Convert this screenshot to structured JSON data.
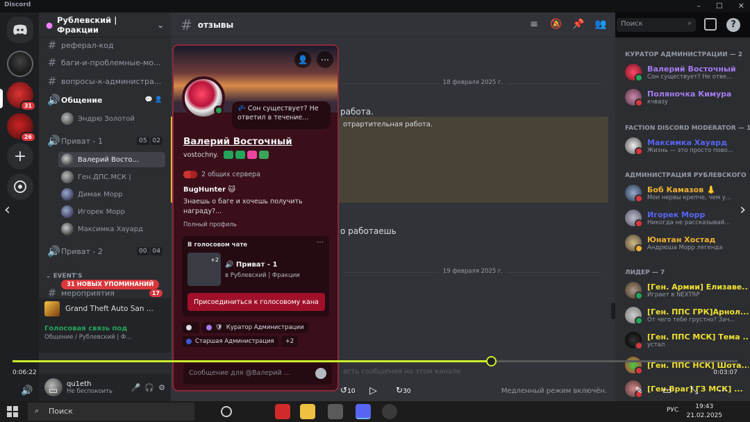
{
  "window": {
    "app": "Discord"
  },
  "rail": {
    "badges": [
      "31",
      "26"
    ]
  },
  "guild": {
    "name": "Рублевский | Фракции"
  },
  "channels": {
    "c1": "реферал-код",
    "c2": "баги-и-проблемные-мо...",
    "c3": "вопросы-к-администра...",
    "voice_general": "Общение",
    "voice_general_user": "Эндрю Золотой",
    "private1": "Приват - 1",
    "private1_counts": [
      "05",
      "02"
    ],
    "private1_users": [
      "Валерий Восто...",
      "Ген.ДПС.МСК |",
      "Димак Морр",
      "Игорек Морр",
      "Максимка Хауард"
    ],
    "private2": "Приват - 2",
    "private2_counts": [
      "00",
      "04"
    ],
    "events_category": "EVENT'S",
    "events_channel": "мероприятия",
    "events_badge": "17",
    "mentions_pill": "31 НОВЫХ УПОМИНАНИЙ"
  },
  "activity": {
    "game": "Grand Theft Auto San ..."
  },
  "voice_status": {
    "title": "Голосовая связь под",
    "sub": "Общение / Рублевский | Ф..."
  },
  "user_panel": {
    "name": "qu1eth",
    "status": "Не беспокоить"
  },
  "chat": {
    "channel": "отзывы",
    "date1": "18 февраля 2025 г.",
    "date2": "19 февраля 2025 г.",
    "line1": "работа.",
    "line2": "отрартительная работа.",
    "line3": "о работаешь",
    "slow_mode": "Медленный режим включён.",
    "footer_hint": "асть сообщения на этом канале"
  },
  "search": {
    "placeholder": "Поиск"
  },
  "members": {
    "categories": [
      "КУРАТОР АДМИНИСТРАЦИИ — 2",
      "FACTION DISCORD MODERATOR — 1",
      "АДМИНИСТРАЦИЯ РУБЛЕВСКОГО",
      "ЛИДЕР — 7"
    ],
    "list": [
      {
        "name": "Валерий Восточный",
        "status": "Сон существует? Не отве...",
        "color": "#a57cf0"
      },
      {
        "name": "Поляночка Кимура",
        "status": "кчвазу",
        "color": "#a57cf0"
      },
      {
        "name": "Максимка Хауард",
        "status": "Жизнь — это просто пово...",
        "color": "#5865f2"
      },
      {
        "name": "Боб Камазов 👃",
        "status": "Мои нервы крепче, чем у...",
        "color": "#f0b232"
      },
      {
        "name": "Игорек Морр",
        "status": "Никогда не рассказывай...",
        "color": "#5865f2"
      },
      {
        "name": "Юнатан Хостад",
        "status": "Андрюша Морр легенда",
        "color": "#f0b232"
      },
      {
        "name": "[Ген. Армии] Елизаве...",
        "status": "Играет в NEXTRP",
        "color": "#f0e032"
      },
      {
        "name": "[Ген. ППС ГРК]Арнол...",
        "status": "От чего тебе грустно? Зач...",
        "color": "#f0e032"
      },
      {
        "name": "[Ген. ППС МСК] Тема ...",
        "status": "устал",
        "color": "#f0e032"
      },
      {
        "name": "[Ген. ППС НСК] Шота...",
        "status": "",
        "color": "#f0e032"
      },
      {
        "name": "[Ген.Враг] ГЗ МСК] ...",
        "status": "",
        "color": "#f0e032"
      }
    ]
  },
  "profile": {
    "display_name": "Валерий Восточный",
    "username": "vostochny.",
    "custom_status": "Сон существует? Не ответил в течение...",
    "mutual_servers": "2 общих сервера",
    "bio_title": "BugHunter 🐱",
    "bio_text": "Знаешь о баге и хочешь получить награду?...",
    "full_profile": "Полный профиль",
    "voice_title": "В голосовом чате",
    "voice_count": "+2",
    "voice_channel": "🔊 Приват - 1",
    "voice_server": "в Рублевский | Фракции",
    "join_button": "Присоединиться к голосовому кана",
    "roles": [
      {
        "label": "",
        "color": "#dbdee1"
      },
      {
        "label": "Куратор Администрации",
        "color": "#a57cf0"
      },
      {
        "label": "Старшая Администрация",
        "color": "#3a5ad0"
      },
      {
        "label": "+2",
        "color": ""
      }
    ],
    "message_placeholder": "Сообщение для @Валерий ...",
    "badge_colors": [
      "#23a55a",
      "#23a55a",
      "#eb459e",
      "#3ba55c"
    ]
  },
  "video": {
    "time_current": "0:06:22",
    "time_total": "0:03:07",
    "progress": 0.66,
    "skip_back": "10",
    "skip_fwd": "30"
  },
  "taskbar": {
    "search": "Поиск",
    "lang": "РУС",
    "time": "19:43",
    "date": "21.02.2025"
  }
}
